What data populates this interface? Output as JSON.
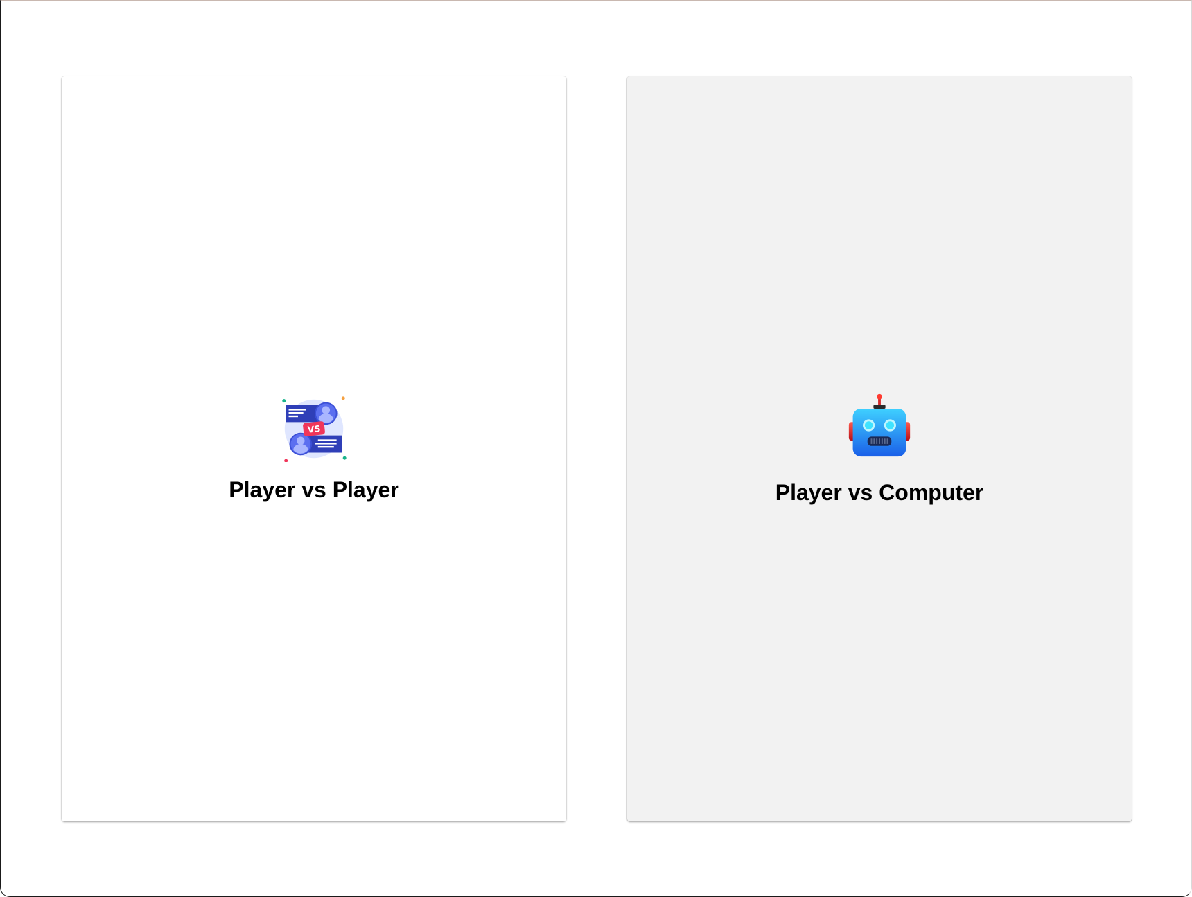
{
  "modes": [
    {
      "id": "pvp",
      "title": "Player vs Player",
      "icon": "players-versus-icon",
      "background": "#ffffff"
    },
    {
      "id": "pvc",
      "title": "Player vs Computer",
      "icon": "robot-icon",
      "background": "#f2f2f2"
    }
  ],
  "colors": {
    "vs_badge": "#f0365a",
    "player_blue": "#3b4fd6",
    "robot_blue": "#1f8ff0",
    "robot_ear": "#e0262c"
  }
}
